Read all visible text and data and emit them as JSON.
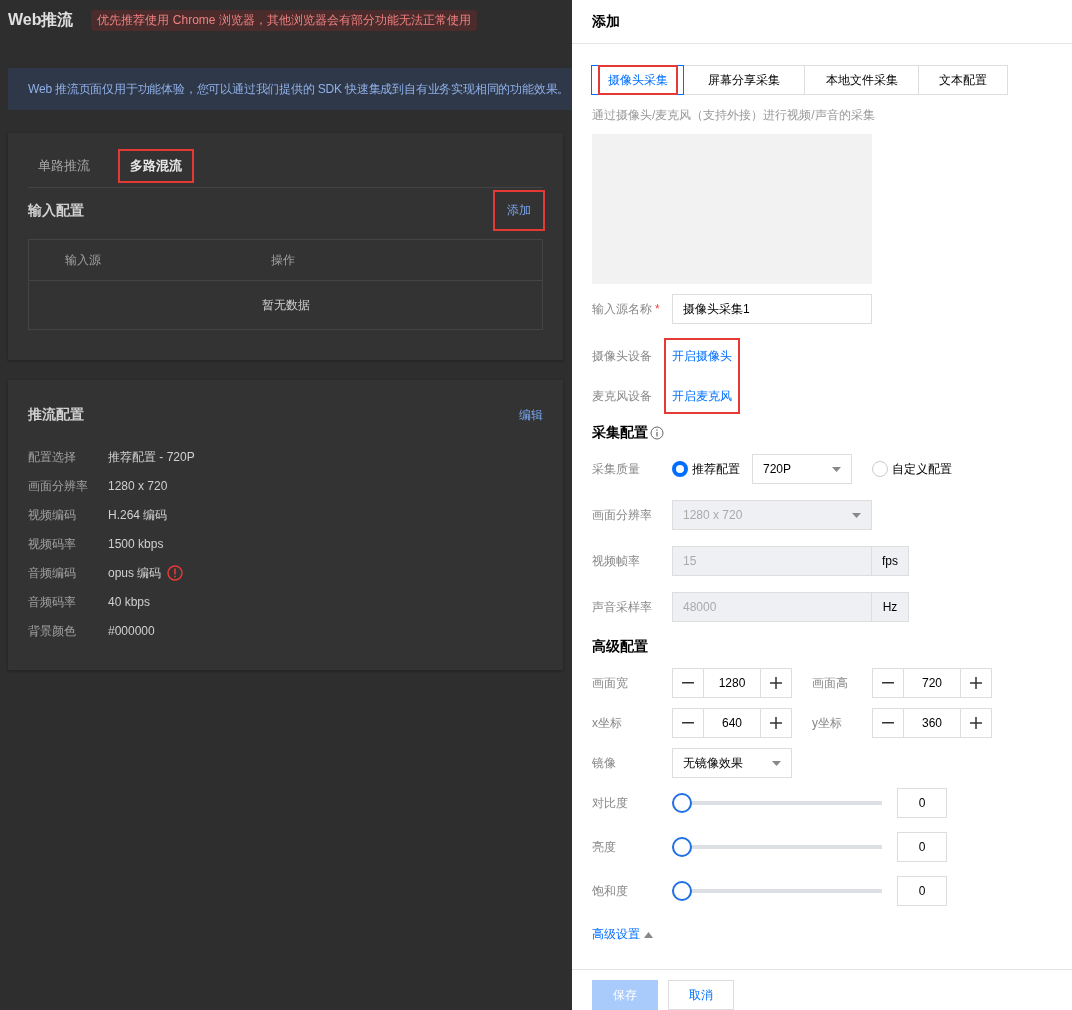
{
  "page": {
    "title": "Web推流",
    "notice": "优先推荐使用 Chrome 浏览器，其他浏览器会有部分功能无法正常使用",
    "banner": "Web 推流页面仅用于功能体验，您可以通过我们提供的 SDK 快速集成到自有业务实现相同的功能效果。",
    "tabs": [
      {
        "label": "单路推流",
        "selected": false,
        "highlighted": false
      },
      {
        "label": "多路混流",
        "selected": true,
        "highlighted": true
      }
    ],
    "input_config": {
      "title": "输入配置",
      "add_button": {
        "label": "添加",
        "highlighted": true
      },
      "table": {
        "columns": [
          "输入源",
          "操作"
        ],
        "empty_text": "暂无数据"
      }
    },
    "stream_config": {
      "title": "推流配置",
      "edit_link": "编辑",
      "rows": [
        {
          "label": "配置选择",
          "value": "推荐配置 - 720P",
          "warning": false
        },
        {
          "label": "画面分辨率",
          "value": "1280 x 720",
          "warning": false
        },
        {
          "label": "视频编码",
          "value": "H.264 编码",
          "warning": false
        },
        {
          "label": "视频码率",
          "value": "1500 kbps",
          "warning": false
        },
        {
          "label": "音频编码",
          "value": "opus 编码",
          "warning": true
        },
        {
          "label": "音频码率",
          "value": "40 kbps",
          "warning": false
        },
        {
          "label": "背景颜色",
          "value": "#000000",
          "warning": false
        }
      ]
    }
  },
  "drawer": {
    "title": "添加",
    "tabs": [
      {
        "label": "摄像头采集",
        "selected": true,
        "highlighted": true
      },
      {
        "label": "屏幕分享采集",
        "selected": false,
        "highlighted": false
      },
      {
        "label": "本地文件采集",
        "selected": false,
        "highlighted": false
      },
      {
        "label": "文本配置",
        "selected": false,
        "highlighted": false
      }
    ],
    "description": "通过摄像头/麦克风（支持外接）进行视频/声音的采集",
    "source_name": {
      "label": "输入源名称",
      "required_mark": "*",
      "value": "摄像头采集1"
    },
    "devices": {
      "highlighted": true,
      "items": [
        {
          "label": "摄像头设备",
          "link": "开启摄像头"
        },
        {
          "label": "麦克风设备",
          "link": "开启麦克风"
        }
      ]
    },
    "capture": {
      "title": "采集配置",
      "quality": {
        "label": "采集质量",
        "options": [
          {
            "label": "推荐配置",
            "selected": true
          },
          {
            "label": "自定义配置",
            "selected": false
          }
        ],
        "preset": "720P"
      },
      "resolution": {
        "label": "画面分辨率",
        "value": "1280 x 720",
        "disabled": true
      },
      "frame_rate": {
        "label": "视频帧率",
        "value": "15",
        "unit": "fps",
        "disabled": true
      },
      "sample_rate": {
        "label": "声音采样率",
        "value": "48000",
        "unit": "Hz",
        "disabled": true
      }
    },
    "advanced": {
      "title": "高级配置",
      "steppers": [
        {
          "label": "画面宽",
          "value": "1280"
        },
        {
          "label": "画面高",
          "value": "720"
        },
        {
          "label": "x坐标",
          "value": "640"
        },
        {
          "label": "y坐标",
          "value": "360"
        }
      ],
      "mirror": {
        "label": "镜像",
        "value": "无镜像效果"
      },
      "sliders": [
        {
          "label": "对比度",
          "level": 0,
          "value": "0"
        },
        {
          "label": "亮度",
          "level": 0,
          "value": "0"
        },
        {
          "label": "饱和度",
          "level": 0,
          "value": "0"
        }
      ],
      "toggle": {
        "label": "高级设置",
        "expanded": true
      }
    },
    "footer": {
      "save": {
        "label": "保存",
        "disabled": true
      },
      "cancel": "取消"
    }
  }
}
